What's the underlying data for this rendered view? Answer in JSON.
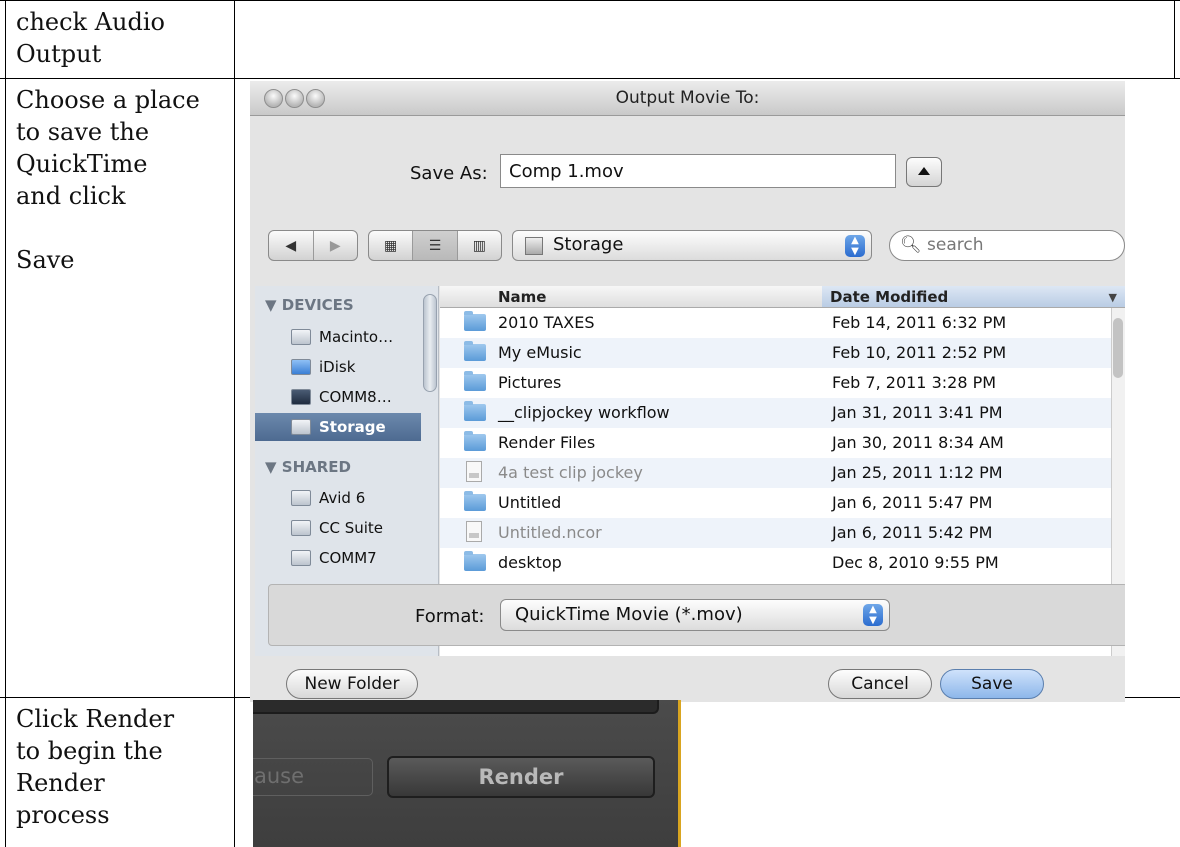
{
  "doc": {
    "row1_text": "check Audio\nOutput",
    "row2_text": "Choose a place\nto save the\nQuickTime\nand click\n\nSave",
    "row3_text": "Click Render\nto begin the\nRender\nprocess"
  },
  "dialog": {
    "title": "Output Movie To:",
    "save_as_label": "Save As:",
    "save_as_value": "Comp 1.mov",
    "location": "Storage",
    "search_placeholder": "search",
    "sidebar": {
      "devices_heading": "DEVICES",
      "devices": [
        "Macinto…",
        "iDisk",
        "COMM8…",
        "Storage"
      ],
      "shared_heading": "SHARED",
      "shared": [
        "Avid 6",
        "CC Suite",
        "COMM7"
      ]
    },
    "columns": {
      "name": "Name",
      "date": "Date Modified"
    },
    "files": [
      {
        "name": "2010 TAXES",
        "date": "Feb 14, 2011 6:32 PM",
        "icon": "folder-icon"
      },
      {
        "name": "My eMusic",
        "date": "Feb 10, 2011 2:52 PM",
        "icon": "folder-icon"
      },
      {
        "name": "Pictures",
        "date": "Feb 7, 2011 3:28 PM",
        "icon": "folder-icon"
      },
      {
        "name": "__clipjockey workflow",
        "date": "Jan 31, 2011 3:41 PM",
        "icon": "folder-icon"
      },
      {
        "name": "Render Files",
        "date": "Jan 30, 2011 8:34 AM",
        "icon": "folder-icon"
      },
      {
        "name": "4a test clip jockey",
        "date": "Jan 25, 2011 1:12 PM",
        "icon": "document-icon"
      },
      {
        "name": "Untitled",
        "date": "Jan 6, 2011 5:47 PM",
        "icon": "folder-icon"
      },
      {
        "name": "Untitled.ncor",
        "date": "Jan 6, 2011 5:42 PM",
        "icon": "document-icon"
      },
      {
        "name": "desktop",
        "date": "Dec 8, 2010 9:55 PM",
        "icon": "folder-icon"
      }
    ],
    "format_label": "Format:",
    "format_value": "QuickTime Movie (*.mov)",
    "new_folder_label": "New Folder",
    "cancel_label": "Cancel",
    "save_label": "Save"
  },
  "render_panel": {
    "pause_label": "ause",
    "render_label": "Render",
    "accent_color": "#d9a520"
  }
}
